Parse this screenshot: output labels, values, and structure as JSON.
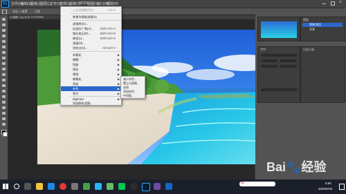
{
  "menubar": {
    "logo": "Ps",
    "items": [
      "文件(F)",
      "编辑(E)",
      "图像(I)",
      "图层(L)",
      "文字(Y)",
      "选择(S)",
      "滤镜(T)",
      "3D(D)",
      "视图(V)",
      "窗口(W)",
      "帮助(H)"
    ]
  },
  "options_bar": {
    "text": "羽化: 0 像素",
    "mode": "正常"
  },
  "document": {
    "tab": "QQ截图...jpg @ 66.7% (RGB/8)"
  },
  "filter_menu": {
    "items": [
      {
        "label": "上次滤镜操作(F)",
        "shortcut": "Ctrl+F",
        "disabled": true
      },
      {
        "label": "转换为智能滤镜(S)"
      },
      {
        "label": "滤镜库(G)..."
      },
      {
        "label": "自适应广角(A)...",
        "shortcut": "Shift+Ctrl+A"
      },
      {
        "label": "镜头校正(R)...",
        "shortcut": "Shift+Ctrl+R"
      },
      {
        "label": "液化(L)...",
        "shortcut": "Shift+Ctrl+X"
      },
      {
        "label": "油画(O)..."
      },
      {
        "label": "消失点(V)...",
        "shortcut": "Alt+Ctrl+V"
      },
      {
        "label": "风格化",
        "submenu": true
      },
      {
        "label": "模糊",
        "submenu": true
      },
      {
        "label": "扭曲",
        "submenu": true
      },
      {
        "label": "锐化",
        "submenu": true
      },
      {
        "label": "视频",
        "submenu": true
      },
      {
        "label": "像素化",
        "submenu": true
      },
      {
        "label": "渲染",
        "submenu": true
      },
      {
        "label": "杂色",
        "submenu": true,
        "highlighted": true
      },
      {
        "label": "其它",
        "submenu": true
      },
      {
        "label": "Digimarc",
        "submenu": true
      },
      {
        "label": "浏览联机滤镜..."
      }
    ],
    "submenu": [
      "减少杂色...",
      "蒙尘与划痕...",
      "去斑",
      "添加杂色...",
      "中间值..."
    ]
  },
  "panels": {
    "layers_header": "图层",
    "layer_items": [
      "背景 拷贝",
      "背景"
    ],
    "char_header": "字符",
    "history_header": "历史记录"
  },
  "taskbar": {
    "ime": "中",
    "time": "9:56",
    "date": "2020/6/19"
  },
  "watermark": "Bai🐾经验",
  "colors": {
    "accent": "#2d66c9",
    "menu_bg": "#f0f0f0",
    "app_bg": "#535353"
  }
}
